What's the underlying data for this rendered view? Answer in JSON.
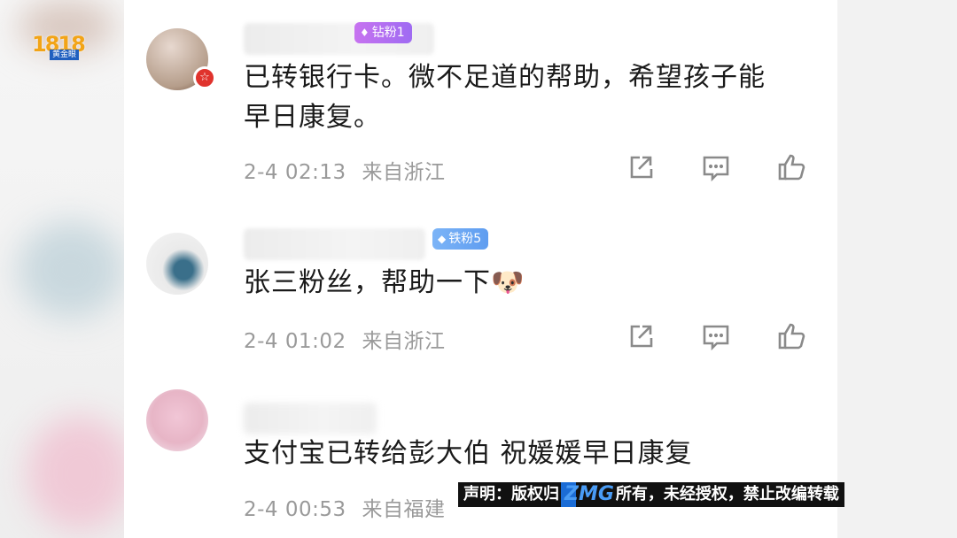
{
  "watermark": {
    "logo_number": "1818",
    "logo_sub": "黄金眼"
  },
  "comments": [
    {
      "badge": {
        "label": "钻粉1",
        "kind": "diamond"
      },
      "text_lines": [
        "已转银行卡。微不足道的帮助，希望孩子能",
        "早日康复。"
      ],
      "time": "2-4 02:13",
      "location": "来自浙江"
    },
    {
      "badge": {
        "label": "铁粉5",
        "kind": "iron"
      },
      "text_lines": [
        "张三粉丝，帮助一下🐶"
      ],
      "time": "2-4 01:02",
      "location": "来自浙江"
    },
    {
      "badge": null,
      "text_lines": [
        "支付宝已转给彭大伯 祝媛媛早日康复"
      ],
      "time": "2-4 00:53",
      "location": "来自福建"
    }
  ],
  "actions": {
    "share_icon": "share-icon",
    "reply_icon": "comment-icon",
    "like_icon": "thumbs-up-icon"
  },
  "banner": {
    "prefix": "声明：版权归",
    "brand": "ZMG",
    "suffix": "所有，未经授权，禁止改编转载"
  },
  "colors": {
    "text": "#1a1a1a",
    "meta": "#9a9a9a",
    "diamond_badge": "#b06ef1",
    "iron_badge": "#6aa8f4",
    "banner_bg": "#111111"
  }
}
